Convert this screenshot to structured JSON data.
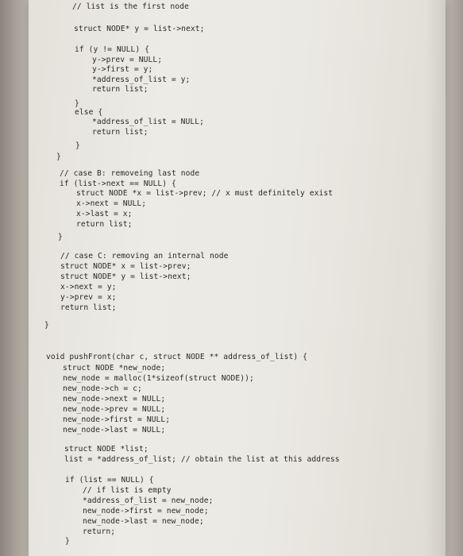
{
  "code": {
    "lines": [
      "// list is the first node",
      "struct NODE* y = list->next;",
      "if (y != NULL) {",
      "y->prev = NULL;",
      "y->first = y;",
      "*address_of_list = y;",
      "return list;",
      "}",
      "else {",
      "*address_of_list = NULL;",
      "return list;",
      "}",
      "}",
      "// case B: removeing last node",
      "if (list->next == NULL) {",
      "struct NODE *x = list->prev; // x must definitely exist",
      "x->next = NULL;",
      "x->last = x;",
      "return list;",
      "}",
      "// case C: removing an internal node",
      "struct NODE* x = list->prev;",
      "struct NODE* y = list->next;",
      "x->next = y;",
      "y->prev = x;",
      "return list;",
      "}",
      "void pushFront(char c, struct NODE ** address_of_list) {",
      "struct NODE *new_node;",
      "new_node = malloc(1*sizeof(struct NODE));",
      "new_node->ch = c;",
      "new_node->next = NULL;",
      "new_node->prev = NULL;",
      "new_node->first = NULL;",
      "new_node->last = NULL;",
      "struct NODE *list;",
      "list = *address_of_list; // obtain the list at this address",
      "if (list == NULL) {",
      "// if list is empty",
      "*address_of_list = new_node;",
      "new_node->first = new_node;",
      "new_node->last = new_node;",
      "return;",
      "}"
    ]
  }
}
